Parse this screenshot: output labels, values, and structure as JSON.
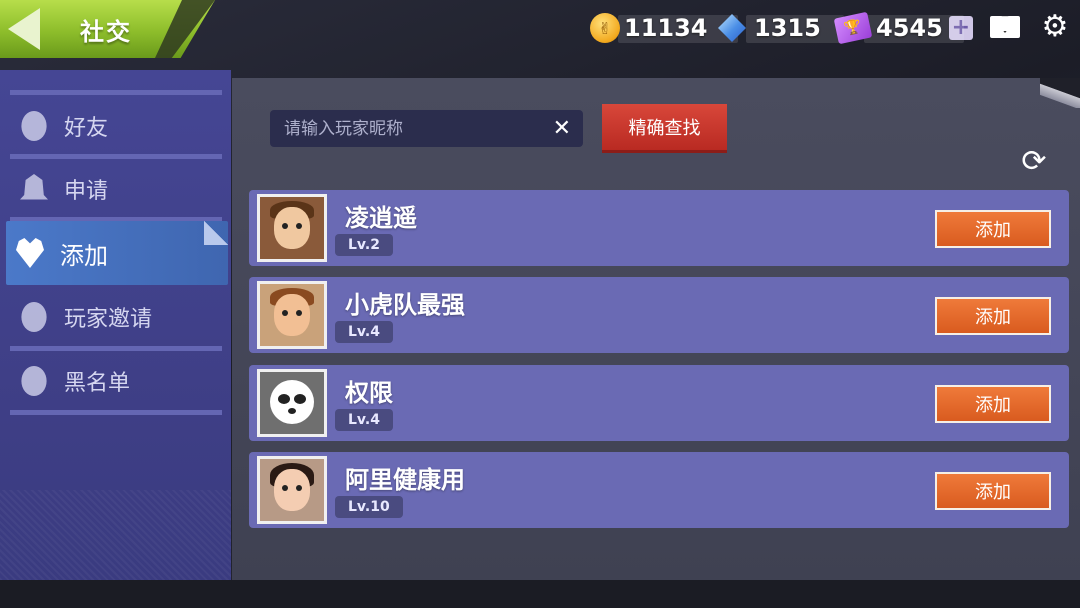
{
  "header": {
    "title": "社交"
  },
  "currencies": {
    "coins": "11134",
    "gems": "1315",
    "tickets": "4545",
    "add_symbol": "+"
  },
  "sidebar": {
    "items": [
      {
        "label": "好友",
        "icon": "friend-head-icon"
      },
      {
        "label": "申请",
        "icon": "bell-icon"
      },
      {
        "label": "添加",
        "icon": "heart-add-icon",
        "active": true
      },
      {
        "label": "玩家邀请",
        "icon": "invite-head-icon"
      },
      {
        "label": "黑名单",
        "icon": "blacklist-head-icon"
      }
    ]
  },
  "search": {
    "placeholder": "请输入玩家昵称",
    "clear_symbol": "✕",
    "button_label": "精确查找"
  },
  "players": [
    {
      "name": "凌逍遥",
      "level": "Lv.2",
      "add_label": "添加"
    },
    {
      "name": "小虎队最强",
      "level": "Lv.4",
      "add_label": "添加"
    },
    {
      "name": "权限",
      "level": "Lv.4",
      "add_label": "添加"
    },
    {
      "name": "阿里健康用",
      "level": "Lv.10",
      "add_label": "添加"
    }
  ],
  "icons": {
    "back": "back-arrow-icon",
    "mail": "mail-icon",
    "settings": "gear-icon",
    "refresh": "refresh-icon"
  },
  "colors": {
    "accent_green": "#8dbd2b",
    "sidebar_bg": "#454694",
    "row_bg": "#6a6ab4",
    "add_button": "#e46a2b",
    "search_button": "#c8352d",
    "active_tab": "#4b79c9"
  }
}
